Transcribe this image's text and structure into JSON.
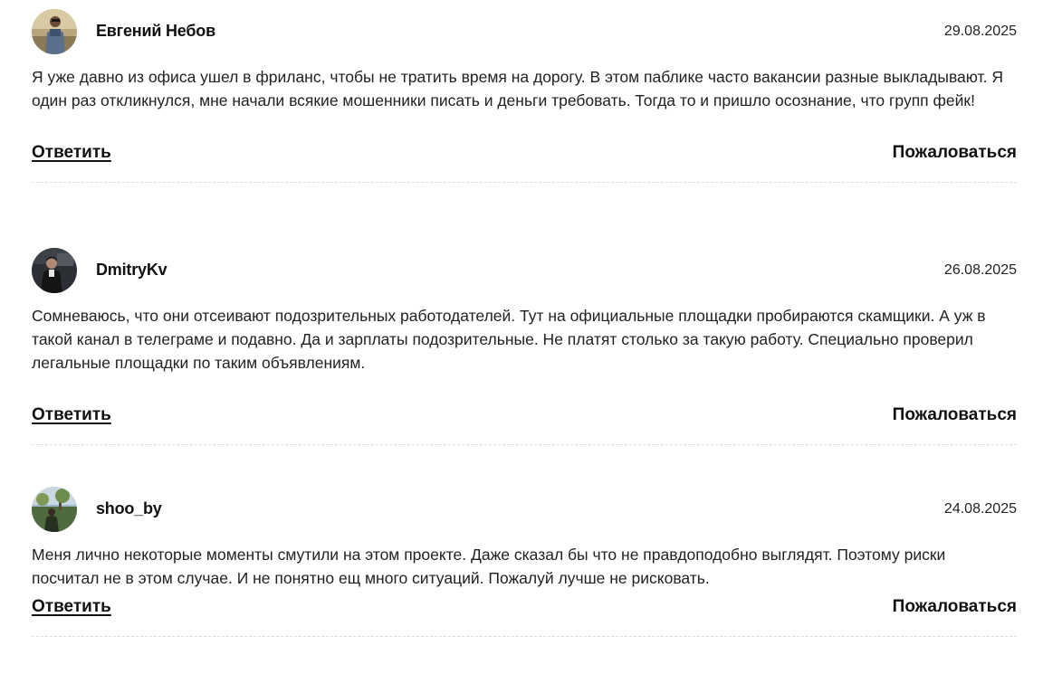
{
  "comments": [
    {
      "author": "Евгений Небов",
      "date": "29.08.2025",
      "avatar_icon": "user-photo",
      "text": "Я уже давно из офиса ушел в фриланс, чтобы не тратить время на дорогу. В этом паблике часто вакансии разные выкладывают. Я один раз откликнулся, мне начали всякие мошенники писать и деньги требовать. Тогда то и пришло осознание, что групп фейк!",
      "reply_label": "Ответить",
      "report_label": "Пожаловаться"
    },
    {
      "author": "DmitryKv",
      "date": "26.08.2025",
      "avatar_icon": "user-photo",
      "text": "Сомневаюсь, что они отсеивают подозрительных работодателей. Тут на официальные площадки пробираются скамщики. А уж в такой канал в телеграме и подавно. Да и зарплаты подозрительные. Не платят столько за такую работу. Специально проверил легальные площадки по таким объявлениям.",
      "reply_label": "Ответить",
      "report_label": "Пожаловаться"
    },
    {
      "author": "shoo_by",
      "date": "24.08.2025",
      "avatar_icon": "user-photo",
      "text": "Меня лично некоторые моменты смутили на этом проекте. Даже сказал бы что не правдоподобно выглядят. Поэтому риски посчитал не в этом случае. И не понятно ещ много ситуаций. Пожалуй лучше не рисковать.",
      "reply_label": "Ответить",
      "report_label": "Пожаловаться"
    }
  ]
}
